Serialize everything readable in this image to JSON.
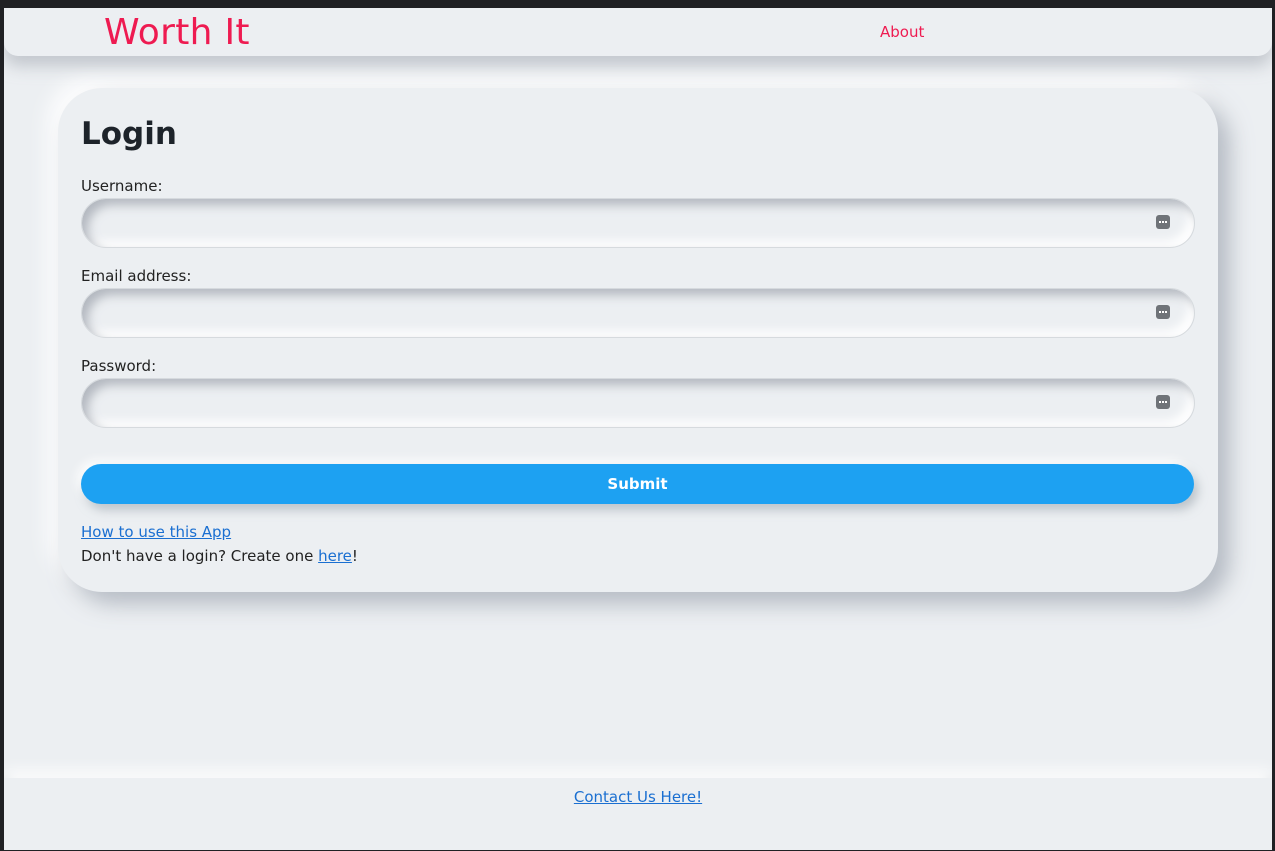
{
  "navbar": {
    "brand": "Worth It",
    "about_label": "About"
  },
  "login": {
    "title": "Login",
    "username_label": "Username:",
    "username_value": "",
    "email_label": "Email address:",
    "email_value": "",
    "password_label": "Password:",
    "password_value": "",
    "submit_label": "Submit",
    "help_link": "How to use this App",
    "signup_prefix": "Don't have a login? Create one ",
    "signup_link": "here",
    "signup_suffix": "!",
    "field_icon": "password-manager-icon"
  },
  "footer": {
    "contact_link": "Contact Us Here!"
  },
  "colors": {
    "brand": "#ee1b51",
    "background": "#eceff2",
    "submit": "#1da1f2",
    "link": "#1a6fd1"
  }
}
